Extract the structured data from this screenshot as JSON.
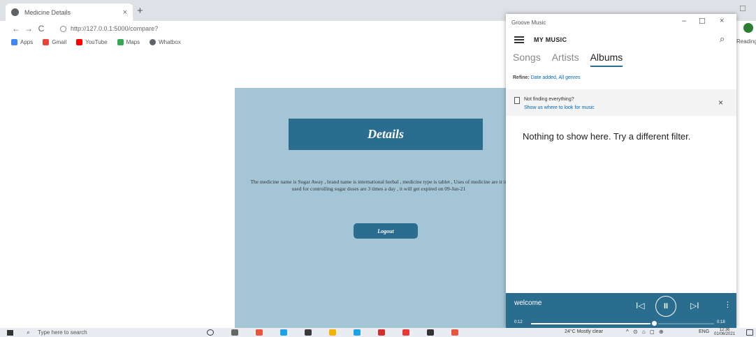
{
  "browser": {
    "tab_title": "Medicine Details",
    "tab_close": "×",
    "new_tab": "+",
    "url": "http://127.0.0.1:5000/compare?",
    "nav": {
      "back": "←",
      "forward": "→",
      "reload": "C"
    },
    "bookmarks": [
      {
        "label": "Apps",
        "color": "#4285f4"
      },
      {
        "label": "Gmail",
        "color": "#ea4335"
      },
      {
        "label": "YouTube",
        "color": "#ff0000"
      },
      {
        "label": "Maps",
        "color": "#34a853"
      },
      {
        "label": "Whatbox",
        "color": "#5f6368"
      }
    ],
    "reading_list": "Reading"
  },
  "page": {
    "details_title": "Details",
    "description": "The medicine name is Sugar Away , brand name is international herbal , medicine type is tablet , Uses of medicine are it is used for controlling sugar doses are 3 times a day , it will get expired on 09-Jan-21",
    "logout_label": "Logout"
  },
  "groove": {
    "app_title": "Groove Music",
    "window_controls": {
      "minimize": "–",
      "maximize": "☐",
      "close": "×"
    },
    "heading": "MY MUSIC",
    "tabs": [
      "Songs",
      "Artists",
      "Albums"
    ],
    "active_tab": "Albums",
    "refine_label": "Refine:",
    "refine_value": "Date added, All genres",
    "notice_title": "Not finding everything?",
    "notice_link": "Show us where to look for music",
    "notice_close": "×",
    "empty_message": "Nothing to show here. Try a different filter.",
    "player": {
      "track": "welcome",
      "elapsed": "0:12",
      "total": "0:18",
      "progress": 0.67,
      "prev": "I◁",
      "pause": "II",
      "next": "▷I",
      "more": "⋮"
    }
  },
  "taskbar": {
    "search_placeholder": "Type here to search",
    "weather": "24°C Mostly clear",
    "tray": "^ ⊙ ⌂ ◻ ⊕",
    "language": "ENG",
    "time": "12:36",
    "date": "01/06/2021",
    "app_colors": [
      "#333333",
      "#666666",
      "#e8553c",
      "#1aa3e8",
      "#3a3a3a",
      "#f4b400",
      "#1aa3e8",
      "#d32f2f",
      "#e53935",
      "#333333",
      "#e8553c"
    ]
  },
  "colors": {
    "accent": "#2a6d8e",
    "panel": "#a3c5d6"
  }
}
